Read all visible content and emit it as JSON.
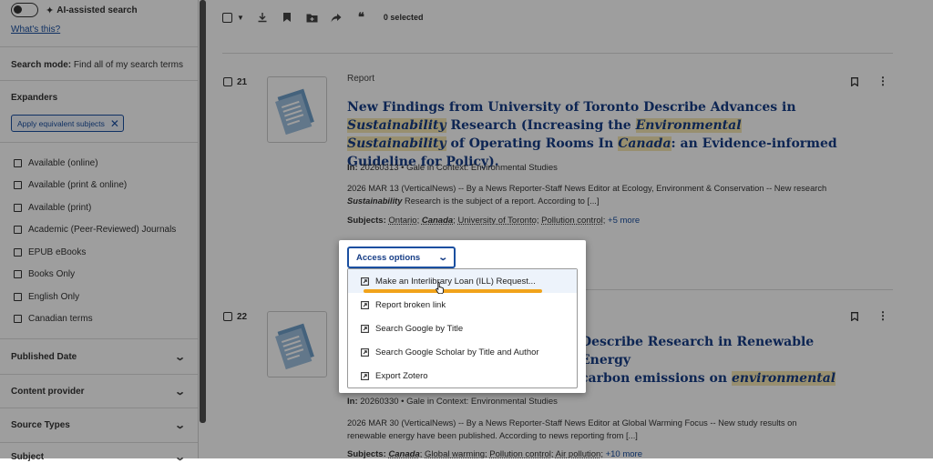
{
  "sidebar": {
    "ai_toggle_label": "AI-assisted search",
    "whats_this": "What's this?",
    "search_mode_label": "Search mode:",
    "search_mode_value": "Find all of my search terms",
    "expanders_title": "Expanders",
    "applied_chip": "Apply equivalent subjects",
    "limiters": [
      "Available (online)",
      "Available (print & online)",
      "Available (print)",
      "Academic (Peer-Reviewed) Journals",
      "EPUB eBooks",
      "Books Only",
      "English Only",
      "Canadian terms"
    ],
    "accordions": [
      "Published Date",
      "Content provider",
      "Source Types",
      "Subject"
    ]
  },
  "toolbar": {
    "selected_count": "0 selected"
  },
  "results": [
    {
      "number": "21",
      "type": "Report",
      "title_parts": [
        {
          "t": "New Findings from University of Toronto Describe Advances in ",
          "hl": false
        },
        {
          "t": "Sustainability",
          "hl": true
        },
        {
          "t": " Research (Increasing the ",
          "hl": false
        },
        {
          "t": "Environmental",
          "hl": true
        },
        {
          "t": " ",
          "hl": false
        },
        {
          "t": "Sustainability",
          "hl": true
        },
        {
          "t": " of Operating Rooms In ",
          "hl": false
        },
        {
          "t": "Canada",
          "hl": true
        },
        {
          "t": ": an Evidence-informed Guideline for Policy).",
          "hl": false
        }
      ],
      "in_label": "In:",
      "source": "20260313 • Gale in Context: Environmental Studies",
      "abstract_1": "2026 MAR 13 (VerticalNews) -- By a News Reporter-Staff News Editor at Ecology, Environment & Conservation -- New research",
      "abstract_2_bold": "Sustainability",
      "abstract_2": " Research is the subject of a report. According to [...]",
      "subjects_label": "Subjects:",
      "subjects": [
        "Ontario",
        "Canada",
        "University of Toronto",
        "Pollution control"
      ],
      "more": "+5 more"
    },
    {
      "number": "22",
      "title_line1": "Describe Research in Renewable Energy",
      "title_line2_pre": "carbon emissions on ",
      "title_line2_hl": "environmental",
      "in_label": "In:",
      "source": "20260330 • Gale in Context: Environmental Studies",
      "abstract_1": "2026 MAR 30 (VerticalNews) -- By a News Reporter-Staff News Editor at Global Warming Focus -- New study results on",
      "abstract_2": "renewable energy have been published. According to news reporting from [...]",
      "subjects_label": "Subjects:",
      "subjects": [
        "Canada",
        "Global warming",
        "Pollution control",
        "Air pollution"
      ],
      "more": "+10 more"
    }
  ],
  "access_popup": {
    "button_label": "Access options",
    "items": [
      "Make an Interlibrary Loan (ILL) Request...",
      "Report broken link",
      "Search Google by Title",
      "Search Google Scholar by Title and Author",
      "Export Zotero"
    ]
  },
  "colors": {
    "link": "#1a4fa0",
    "title": "#163d86",
    "highlight": "#f6e7b3",
    "annotation_underline": "#f1a31b"
  },
  "icons": [
    "sparkle-icon",
    "download-icon",
    "bookmark-icon",
    "folder-icon",
    "share-icon",
    "quote-icon",
    "chevron-down-icon",
    "external-link-icon",
    "more-vertical-icon",
    "close-icon",
    "hand-cursor-icon"
  ]
}
